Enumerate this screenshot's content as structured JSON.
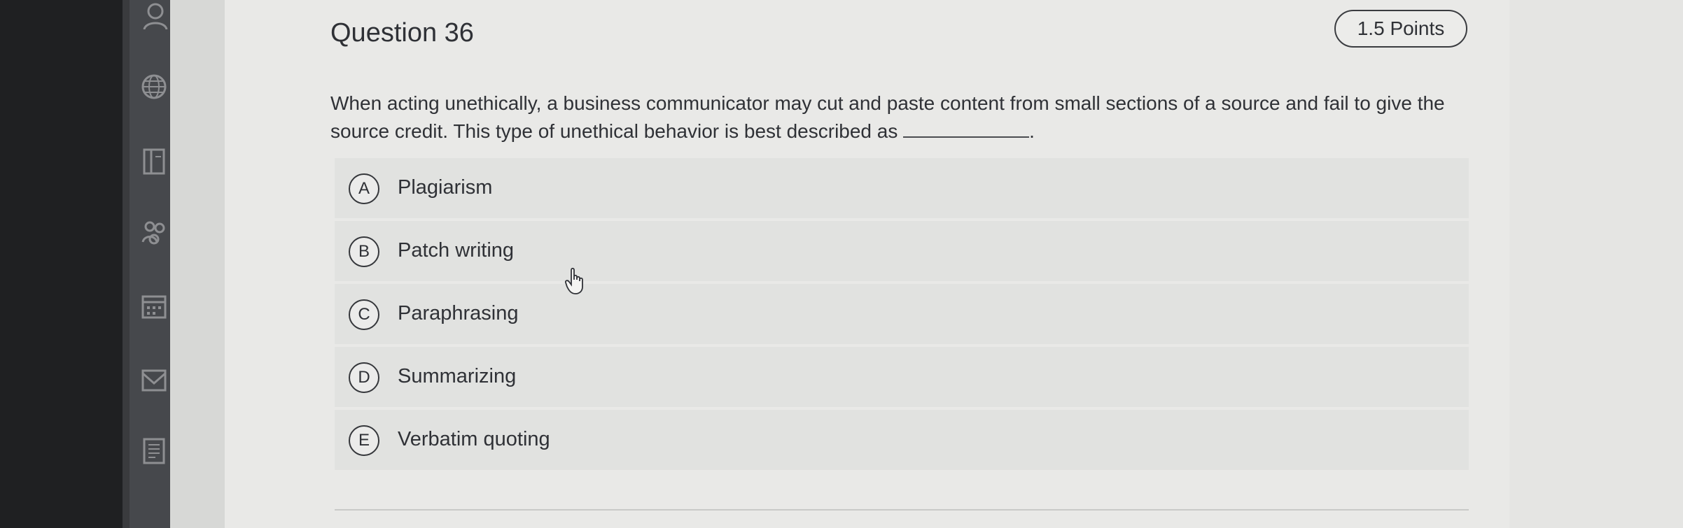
{
  "question": {
    "title": "Question 36",
    "points": "1.5 Points",
    "text": "When acting unethically, a business communicator may cut and paste content from small sections of a source and fail to give the source credit. This type of unethical behavior is best described as",
    "text_end": "."
  },
  "options": [
    {
      "letter": "A",
      "label": "Plagiarism"
    },
    {
      "letter": "B",
      "label": "Patch writing"
    },
    {
      "letter": "C",
      "label": "Paraphrasing"
    },
    {
      "letter": "D",
      "label": "Summarizing"
    },
    {
      "letter": "E",
      "label": "Verbatim quoting"
    }
  ],
  "sidebar": {
    "icons": [
      "person-icon",
      "globe-icon",
      "book-icon",
      "group-icon",
      "calendar-icon",
      "inbox-icon",
      "document-icon"
    ]
  },
  "colors": {
    "text": "#2f3136",
    "panel": "#e9e9e7",
    "option_bg": "#e1e2e0",
    "sidebar": "#46484c"
  }
}
